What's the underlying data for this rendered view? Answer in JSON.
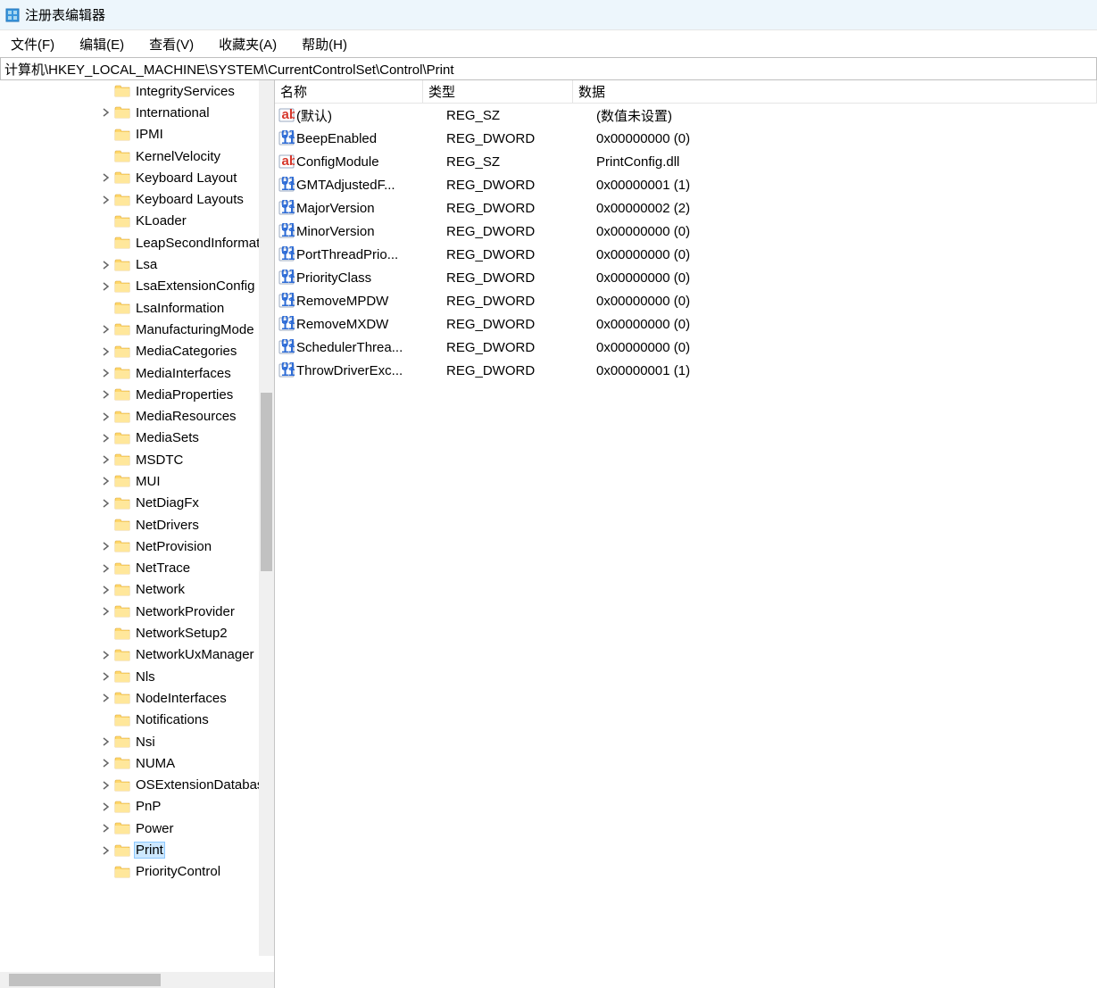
{
  "window": {
    "title": "注册表编辑器"
  },
  "menu": {
    "file": "文件(F)",
    "edit": "编辑(E)",
    "view": "查看(V)",
    "favorites": "收藏夹(A)",
    "help": "帮助(H)"
  },
  "path": "计算机\\HKEY_LOCAL_MACHINE\\SYSTEM\\CurrentControlSet\\Control\\Print",
  "columns": {
    "name": "名称",
    "type": "类型",
    "data": "数据"
  },
  "tree": [
    {
      "label": "IntegrityServices",
      "expandable": false
    },
    {
      "label": "International",
      "expandable": true
    },
    {
      "label": "IPMI",
      "expandable": false
    },
    {
      "label": "KernelVelocity",
      "expandable": false
    },
    {
      "label": "Keyboard Layout",
      "expandable": true
    },
    {
      "label": "Keyboard Layouts",
      "expandable": true
    },
    {
      "label": "KLoader",
      "expandable": false
    },
    {
      "label": "LeapSecondInformation",
      "expandable": false
    },
    {
      "label": "Lsa",
      "expandable": true
    },
    {
      "label": "LsaExtensionConfig",
      "expandable": true
    },
    {
      "label": "LsaInformation",
      "expandable": false
    },
    {
      "label": "ManufacturingMode",
      "expandable": true
    },
    {
      "label": "MediaCategories",
      "expandable": true
    },
    {
      "label": "MediaInterfaces",
      "expandable": true
    },
    {
      "label": "MediaProperties",
      "expandable": true
    },
    {
      "label": "MediaResources",
      "expandable": true
    },
    {
      "label": "MediaSets",
      "expandable": true
    },
    {
      "label": "MSDTC",
      "expandable": true
    },
    {
      "label": "MUI",
      "expandable": true
    },
    {
      "label": "NetDiagFx",
      "expandable": true
    },
    {
      "label": "NetDrivers",
      "expandable": false
    },
    {
      "label": "NetProvision",
      "expandable": true
    },
    {
      "label": "NetTrace",
      "expandable": true
    },
    {
      "label": "Network",
      "expandable": true
    },
    {
      "label": "NetworkProvider",
      "expandable": true
    },
    {
      "label": "NetworkSetup2",
      "expandable": false
    },
    {
      "label": "NetworkUxManager",
      "expandable": true
    },
    {
      "label": "Nls",
      "expandable": true
    },
    {
      "label": "NodeInterfaces",
      "expandable": true
    },
    {
      "label": "Notifications",
      "expandable": false
    },
    {
      "label": "Nsi",
      "expandable": true
    },
    {
      "label": "NUMA",
      "expandable": true
    },
    {
      "label": "OSExtensionDatabase",
      "expandable": true
    },
    {
      "label": "PnP",
      "expandable": true
    },
    {
      "label": "Power",
      "expandable": true
    },
    {
      "label": "Print",
      "expandable": true,
      "selected": true
    },
    {
      "label": "PriorityControl",
      "expandable": false
    }
  ],
  "values": [
    {
      "name": "(默认)",
      "type": "REG_SZ",
      "data": "(数值未设置)",
      "icon": "string"
    },
    {
      "name": "BeepEnabled",
      "type": "REG_DWORD",
      "data": "0x00000000 (0)",
      "icon": "binary"
    },
    {
      "name": "ConfigModule",
      "type": "REG_SZ",
      "data": "PrintConfig.dll",
      "icon": "string"
    },
    {
      "name": "GMTAdjustedF...",
      "type": "REG_DWORD",
      "data": "0x00000001 (1)",
      "icon": "binary"
    },
    {
      "name": "MajorVersion",
      "type": "REG_DWORD",
      "data": "0x00000002 (2)",
      "icon": "binary"
    },
    {
      "name": "MinorVersion",
      "type": "REG_DWORD",
      "data": "0x00000000 (0)",
      "icon": "binary"
    },
    {
      "name": "PortThreadPrio...",
      "type": "REG_DWORD",
      "data": "0x00000000 (0)",
      "icon": "binary"
    },
    {
      "name": "PriorityClass",
      "type": "REG_DWORD",
      "data": "0x00000000 (0)",
      "icon": "binary"
    },
    {
      "name": "RemoveMPDW",
      "type": "REG_DWORD",
      "data": "0x00000000 (0)",
      "icon": "binary"
    },
    {
      "name": "RemoveMXDW",
      "type": "REG_DWORD",
      "data": "0x00000000 (0)",
      "icon": "binary"
    },
    {
      "name": "SchedulerThrea...",
      "type": "REG_DWORD",
      "data": "0x00000000 (0)",
      "icon": "binary"
    },
    {
      "name": "ThrowDriverExc...",
      "type": "REG_DWORD",
      "data": "0x00000001 (1)",
      "icon": "binary"
    }
  ]
}
